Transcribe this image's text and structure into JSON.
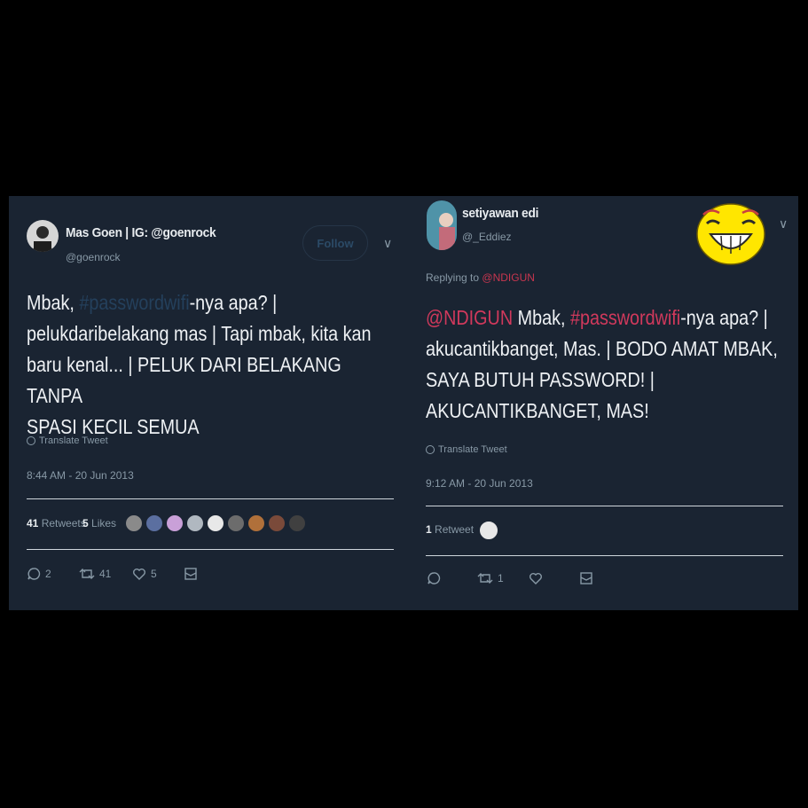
{
  "left_tweet": {
    "name": "Mas Goen | IG: @goenrock",
    "handle": "@goenrock",
    "follow_label": "Follow",
    "caret": "∨",
    "text_prefix": "Mbak, ",
    "hashtag": "#passwordwifi",
    "text_line1_rest": "-nya apa? |",
    "text_line2": "pelukdaribelakang mas | Tapi mbak, kita kan",
    "text_line3": "baru kenal... | PELUK DARI BELAKANG TANPA",
    "text_line4": "SPASI KECIL SEMUA",
    "translate": "Translate Tweet",
    "timestamp": "8:44 AM - 20 Jun 2013",
    "retweets_count": "41",
    "retweets_label": "Retweets",
    "likes_count": "5",
    "likes_label": "Likes",
    "reply_count": "2",
    "retweet_count": "41",
    "like_count": "5"
  },
  "right_tweet": {
    "name": "setiyawan edi",
    "handle": "@_Eddiez",
    "caret": "∨",
    "replying_label": "Replying to",
    "replying_to": "@NDIGUN",
    "mention": "@NDIGUN",
    "text_line1_a": " Mbak, ",
    "hashtag": "#passwordwifi",
    "text_line1_b": "-nya apa? |",
    "text_line2": "akucantikbanget, Mas. | BODO AMAT MBAK,",
    "text_line3": "SAYA BUTUH PASSWORD! |",
    "text_line4": "AKUCANTIKBANGET, MAS!",
    "translate": "Translate Tweet",
    "timestamp": "9:12 AM - 20 Jun 2013",
    "retweets_count": "1",
    "retweets_label": "Retweet",
    "retweet_count": "1"
  },
  "colors": {
    "background": "#1a2432",
    "hashtag_dim": "#24405c",
    "hashtag_red": "#d1395c",
    "emoji_yellow": "#ffe600"
  }
}
